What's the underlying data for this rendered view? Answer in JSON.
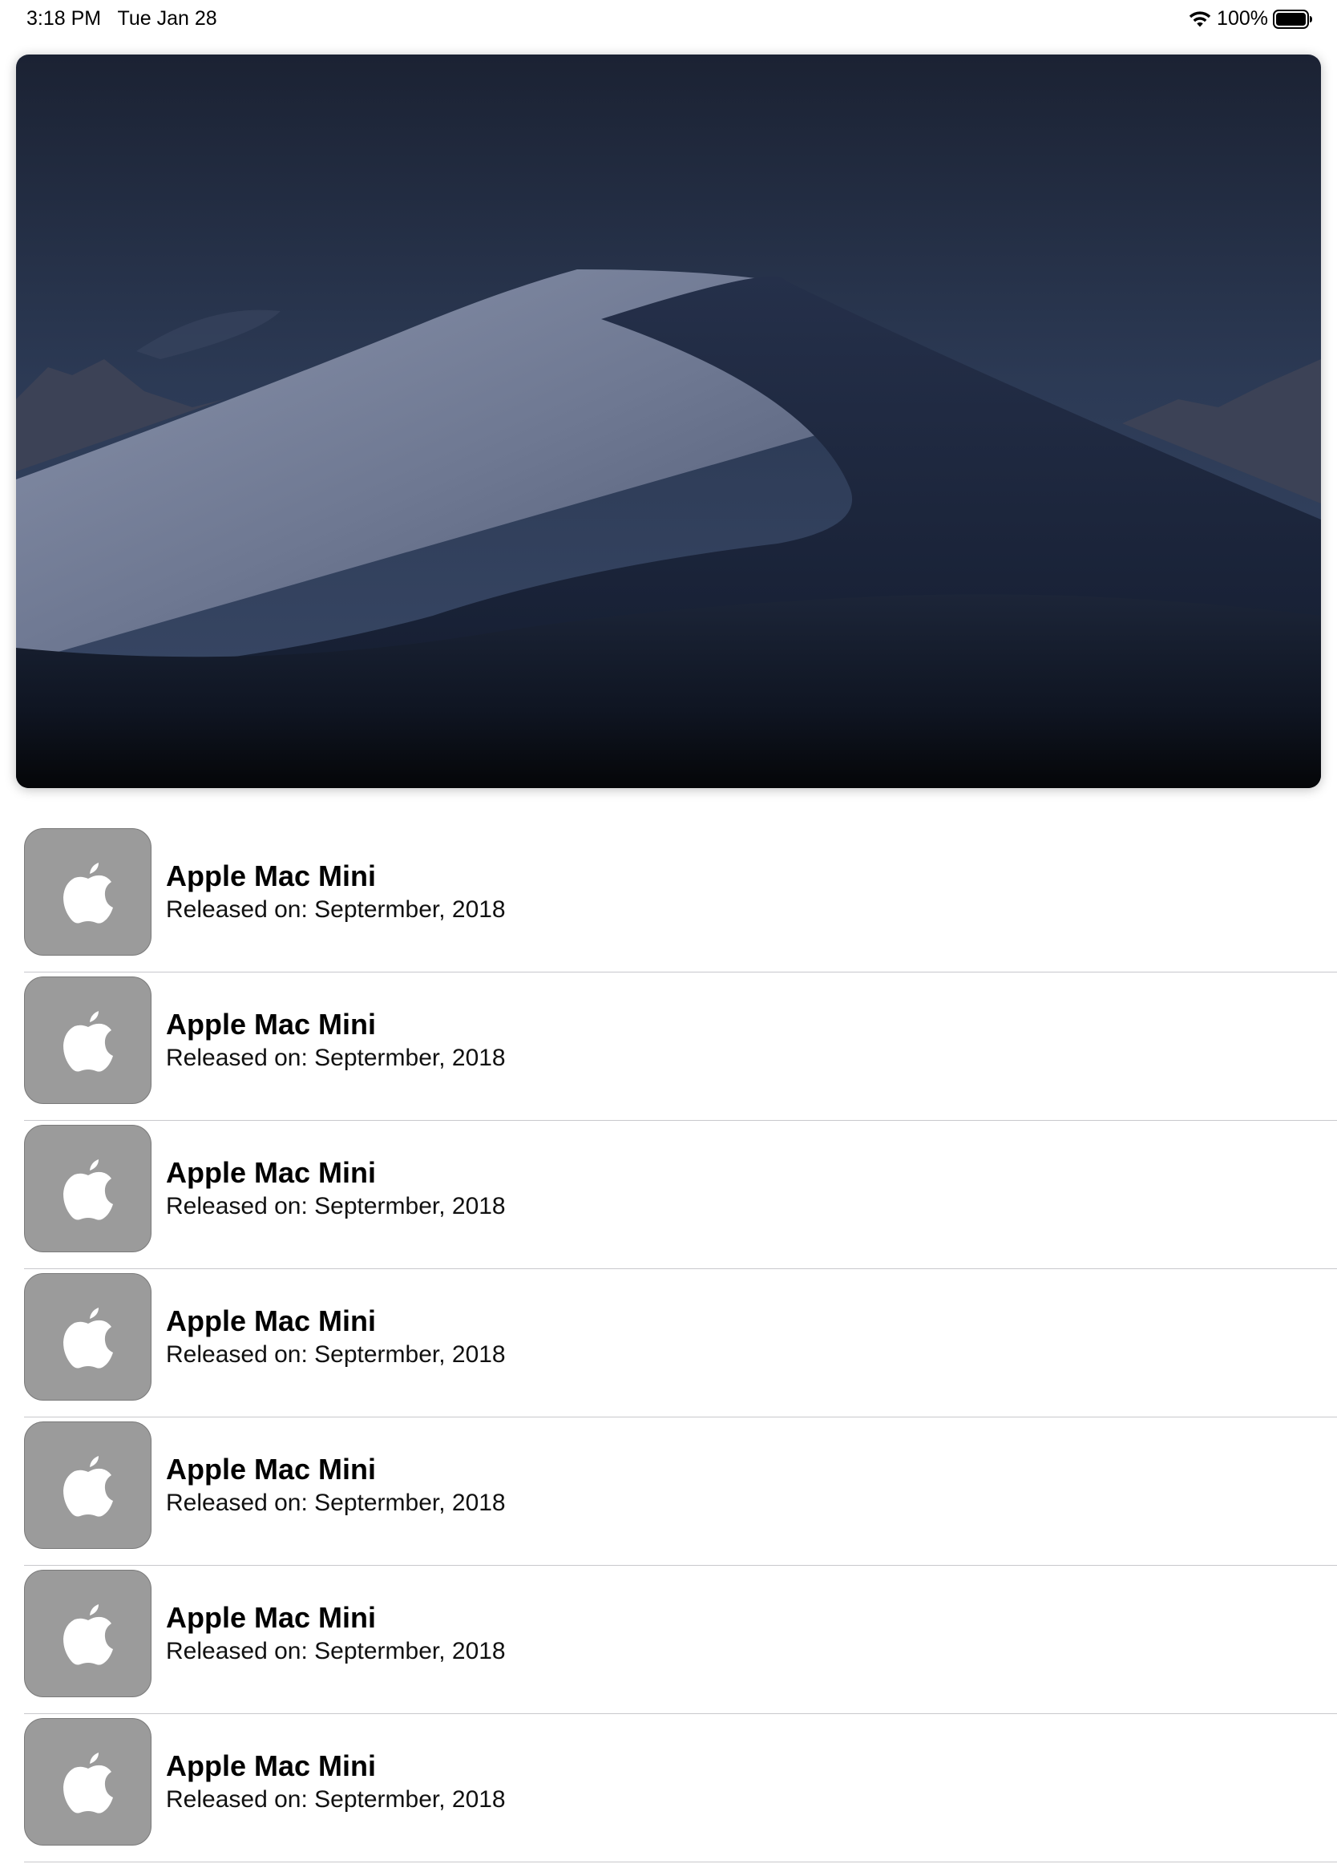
{
  "status_bar": {
    "time": "3:18 PM   Tue Jan 28",
    "battery": "100%"
  },
  "hero": {
    "image": "desert-dune-night-wallpaper"
  },
  "list": {
    "items": [
      {
        "title": "Apple Mac Mini",
        "subtitle": "Released on: Septermber, 2018",
        "icon": "apple-logo-icon"
      },
      {
        "title": "Apple Mac Mini",
        "subtitle": "Released on: Septermber, 2018",
        "icon": "apple-logo-icon"
      },
      {
        "title": "Apple Mac Mini",
        "subtitle": "Released on: Septermber, 2018",
        "icon": "apple-logo-icon"
      },
      {
        "title": "Apple Mac Mini",
        "subtitle": "Released on: Septermber, 2018",
        "icon": "apple-logo-icon"
      },
      {
        "title": "Apple Mac Mini",
        "subtitle": "Released on: Septermber, 2018",
        "icon": "apple-logo-icon"
      },
      {
        "title": "Apple Mac Mini",
        "subtitle": "Released on: Septermber, 2018",
        "icon": "apple-logo-icon"
      },
      {
        "title": "Apple Mac Mini",
        "subtitle": "Released on: Septermber, 2018",
        "icon": "apple-logo-icon"
      }
    ]
  },
  "colors": {
    "icon_tile": "#9b9b9b",
    "divider": "#c8c8cc"
  }
}
